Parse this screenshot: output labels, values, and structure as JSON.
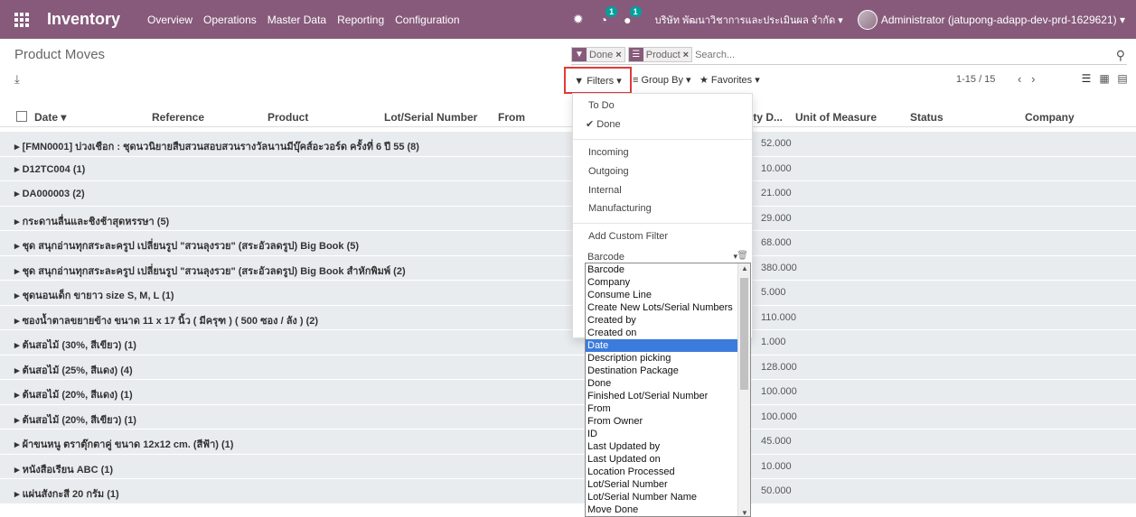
{
  "navbar": {
    "brand": "Inventory",
    "menu": [
      "Overview",
      "Operations",
      "Master Data",
      "Reporting",
      "Configuration"
    ],
    "activity_badge": "1",
    "messages_badge": "1",
    "company": "บริษัท พัฒนาวิชาการและประเมินผล จำกัด ▾",
    "user": "Administrator (jatupong-adapp-dev-prd-1629621) ▾"
  },
  "breadcrumb": "Product Moves",
  "search": {
    "facets": [
      {
        "icon": "filter",
        "label": "Done"
      },
      {
        "icon": "groupby",
        "label": "Product"
      }
    ],
    "placeholder": "Search..."
  },
  "toolbar": {
    "filters": "▼ Filters ▾",
    "group_by": "≡ Group By ▾",
    "favorites": "★ Favorites ▾",
    "pager": "1-15 / 15"
  },
  "columns": [
    "Date ▾",
    "Reference",
    "Product",
    "Lot/Serial Number",
    "From",
    "ity D...",
    "Unit of Measure",
    "Status",
    "Company"
  ],
  "groups": [
    {
      "label": "▸ [FMN0001] บ่วงเชือก : ชุดนวนิยายสืบสวนสอบสวนรางวัลนานมีบุ๊คส์อะวอร์ด ครั้งที่ 6 ปี 55 (8)",
      "qty": "52.000"
    },
    {
      "label": "▸ D12TC004 (1)",
      "qty": "10.000"
    },
    {
      "label": "▸ DA000003 (2)",
      "qty": "21.000"
    },
    {
      "label": "▸ กระดานลื่นและชิงช้าสุดหรรษา (5)",
      "qty": "29.000"
    },
    {
      "label": "▸ ชุด สนุกอ่านทุกสระละครูป เปลี่ยนรูป \"สวนลุงรวย\" (สระอัวลดรูป) Big Book (5)",
      "qty": "68.000"
    },
    {
      "label": "▸ ชุด สนุกอ่านทุกสระละครูป เปลี่ยนรูป \"สวนลุงรวย\" (สระอัวลดรูป) Big Book สำหักพิมพ์ (2)",
      "qty": "380.000"
    },
    {
      "label": "▸ ชุดนอนเด็ก ขายาว size S, M, L (1)",
      "qty": "5.000"
    },
    {
      "label": "▸ ซองน้ำตาลขยายข้าง ขนาด 11 x 17 นิ้ว ( มีครุฑ ) ( 500 ซอง / ลัง ) (2)",
      "qty": "110.000"
    },
    {
      "label": "▸ ต้นสอไม้ (30%, สีเขียว) (1)",
      "qty": "1.000"
    },
    {
      "label": "▸ ต้นสอไม้ (25%, สีแดง) (4)",
      "qty": "128.000"
    },
    {
      "label": "▸ ต้นสอไม้ (20%, สีแดง) (1)",
      "qty": "100.000"
    },
    {
      "label": "▸ ต้นสอไม้ (20%, สีเขียว) (1)",
      "qty": "100.000"
    },
    {
      "label": "▸ ผ้าขนหนู ตราตุ๊กตาคู่ ขนาด 12x12 cm. (สีฟ้า) (1)",
      "qty": "45.000"
    },
    {
      "label": "▸ หนังสือเรียน ABC (1)",
      "qty": "10.000"
    },
    {
      "label": "▸ แผ่นสังกะสี 20 กรัม (1)",
      "qty": "50.000"
    }
  ],
  "filters_menu": {
    "todo": "To Do",
    "done": "✔ Done",
    "incoming": "Incoming",
    "outgoing": "Outgoing",
    "internal": "Internal",
    "manufacturing": "Manufacturing",
    "add_custom": "Add Custom Filter",
    "select_value": "Barcode"
  },
  "field_options": [
    "Barcode",
    "Company",
    "Consume Line",
    "Create New Lots/Serial Numbers",
    "Created by",
    "Created on",
    "Date",
    "Description picking",
    "Destination Package",
    "Done",
    "Finished Lot/Serial Number",
    "From",
    "From Owner",
    "ID",
    "Last Updated by",
    "Last Updated on",
    "Location Processed",
    "Lot/Serial Number",
    "Lot/Serial Number Name",
    "Move Done"
  ],
  "selected_field": "Date",
  "colors": {
    "navbar": "#875a7b",
    "group_row": "#e9ecef",
    "highlight": "#e03a3a",
    "selection": "#3b7bdc"
  }
}
